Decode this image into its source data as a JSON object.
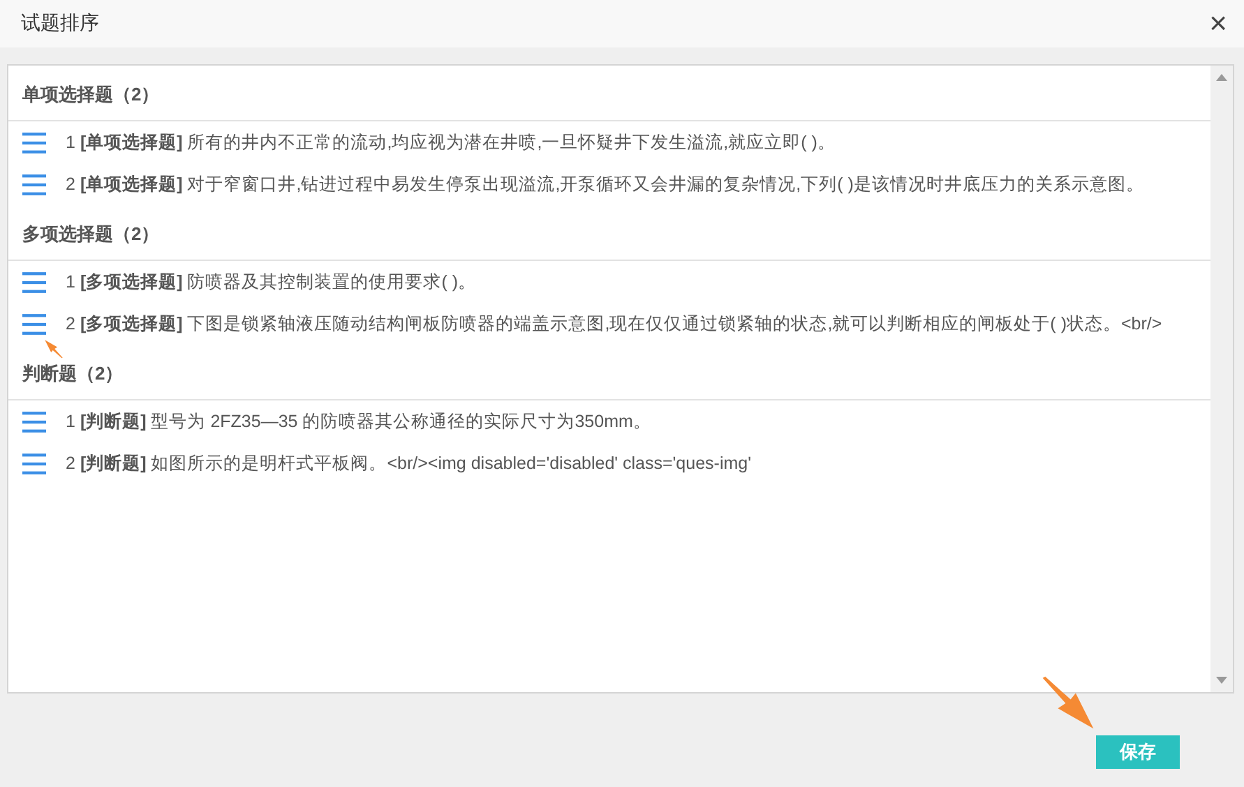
{
  "window": {
    "title": "试题排序",
    "close": "×"
  },
  "sections": [
    {
      "title": "单项选择题（2）",
      "items": [
        {
          "text": "1 **[单项选择题]** 所有的井内不正常的流动,均应视为潜在井喷,一旦怀疑井下发生溢流,就应立即( )。"
        },
        {
          "text": "2 **[单项选择题]** 对于窄窗口井,钻进过程中易发生停泵出现溢流,开泵循环又会井漏的复杂情况,下列( )是该情况时井底压力的关系示意图。"
        }
      ]
    },
    {
      "title": "多项选择题（2）",
      "items": [
        {
          "text": "1 **[多项选择题]** 防喷器及其控制装置的使用要求( )。"
        },
        {
          "text": "2 **[多项选择题]** 下图是锁紧轴液压随动结构闸板防喷器的端盖示意图,现在仅仅通过锁紧轴的状态,就可以判断相应的闸板处于( )状态。<br/>"
        }
      ]
    },
    {
      "title": "判断题（2）",
      "items": [
        {
          "text": "1 **[判断题]** 型号为 2FZ35—35 的防喷器其公称通径的实际尺寸为350mm。"
        },
        {
          "text": "2 **[判断题]** 如图所示的是明杆式平板阀。<br/><img disabled='disabled' class='ques-img'"
        }
      ]
    }
  ],
  "buttons": [
    "保存"
  ]
}
